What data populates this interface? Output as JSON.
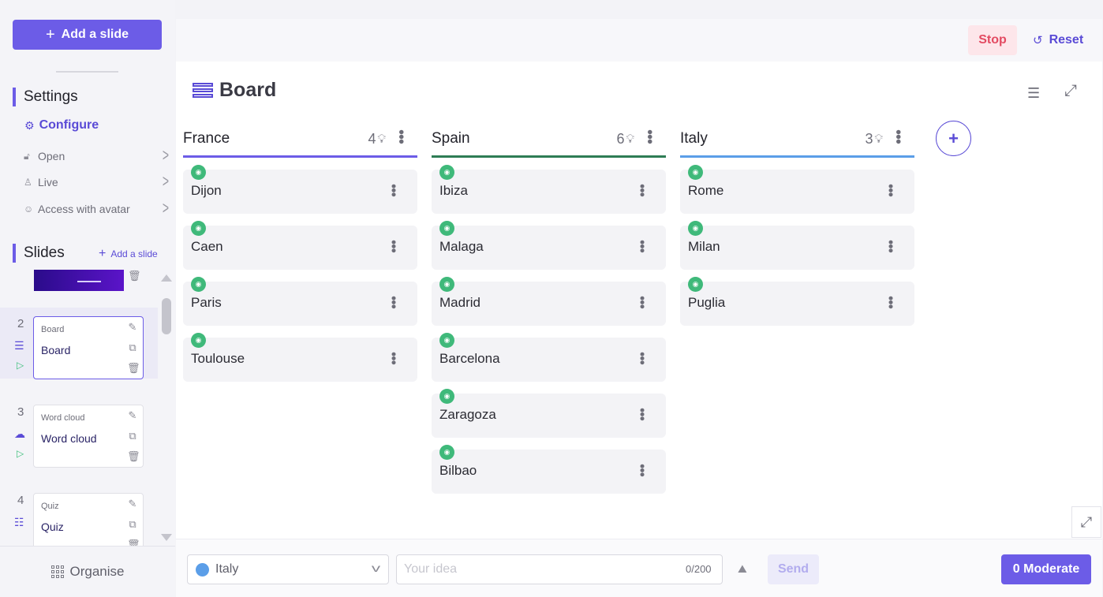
{
  "sidebar": {
    "add_slide_label": "Add a slide",
    "settings_title": "Settings",
    "configure_label": "Configure",
    "settings_items": [
      {
        "label": "Open",
        "icon": "unlock-icon"
      },
      {
        "label": "Live",
        "icon": "person-icon"
      },
      {
        "label": "Access with avatar",
        "icon": "avatar-icon"
      }
    ],
    "slides_title": "Slides",
    "slides_add_label": "Add a slide",
    "slides": [
      {
        "number": "2",
        "type": "Board",
        "title": "Board",
        "icon": "board-icon",
        "active": true
      },
      {
        "number": "3",
        "type": "Word cloud",
        "title": "Word cloud",
        "icon": "cloud-icon",
        "active": false
      },
      {
        "number": "4",
        "type": "Quiz",
        "title": "Quiz",
        "icon": "quiz-icon",
        "active": false
      }
    ],
    "organise_label": "Organise"
  },
  "header": {
    "stop_label": "Stop",
    "reset_label": "Reset"
  },
  "board": {
    "title": "Board",
    "columns": [
      {
        "name": "France",
        "count": "4",
        "color": "#6c5ce7",
        "cards": [
          "Dijon",
          "Caen",
          "Paris",
          "Toulouse"
        ]
      },
      {
        "name": "Spain",
        "count": "6",
        "color": "#2e7d55",
        "cards": [
          "Ibiza",
          "Malaga",
          "Madrid",
          "Barcelona",
          "Zaragoza",
          "Bilbao"
        ]
      },
      {
        "name": "Italy",
        "count": "3",
        "color": "#5b9ee8",
        "cards": [
          "Rome",
          "Milan",
          "Puglia"
        ]
      }
    ]
  },
  "composer": {
    "selected_column": "Italy",
    "selected_color": "#5b9ee8",
    "idea_placeholder": "Your idea",
    "idea_value": "",
    "char_count": "0/200",
    "send_label": "Send",
    "moderate_label": "0 Moderate"
  },
  "colors": {
    "accent": "#6c5ce7",
    "stop": "#e34b62",
    "badge": "#3fb97a"
  }
}
